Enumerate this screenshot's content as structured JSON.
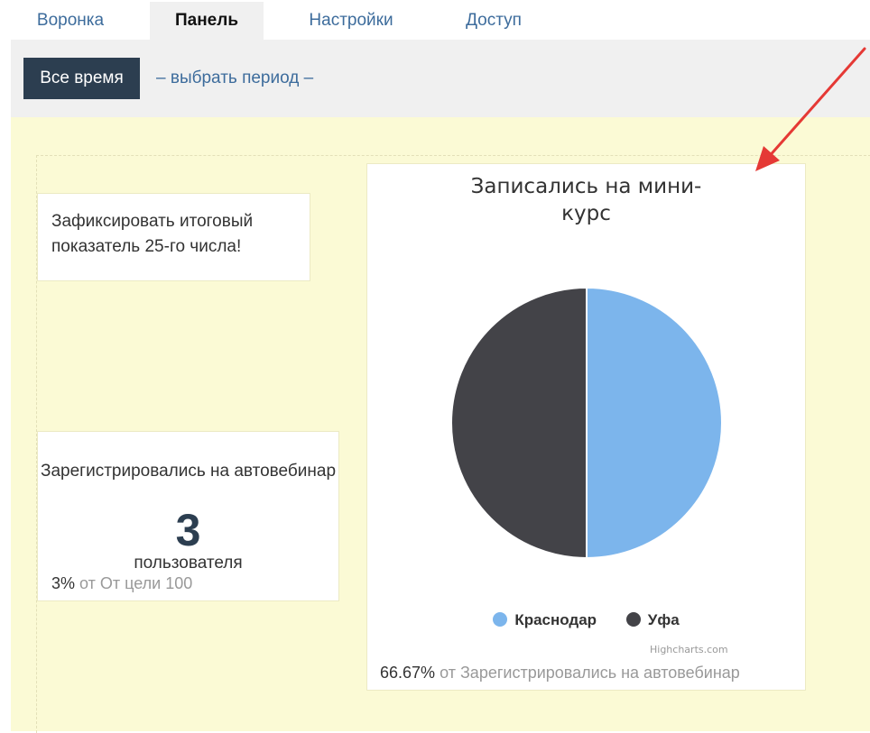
{
  "tabs": [
    {
      "label": "Воронка",
      "active": false
    },
    {
      "label": "Панель",
      "active": true
    },
    {
      "label": "Настройки",
      "active": false
    },
    {
      "label": "Доступ",
      "active": false
    }
  ],
  "toolbar": {
    "period_button": "Все время",
    "period_link": "– выбрать период –"
  },
  "widgets": {
    "note": {
      "text": "Зафиксировать итоговый показатель 25-го числа!"
    },
    "registered": {
      "title": "Зарегистрировались на автовебинар",
      "value": "3",
      "unit": "пользователя",
      "percent": "3%",
      "goal_text": "от От цели 100"
    },
    "chart_card": {
      "percent": "66.67%",
      "relative_text": "от Зарегистрировались на автовебинар",
      "credit": "Highcharts.com"
    }
  },
  "chart_data": {
    "type": "pie",
    "title": "Записались на мини-курс",
    "series": [
      {
        "name": "Краснодар",
        "value": 1,
        "color": "#7cb5ec"
      },
      {
        "name": "Уфа",
        "value": 1,
        "color": "#434348"
      }
    ],
    "legend_position": "bottom-center"
  },
  "colors": {
    "accent": "#2c3e50",
    "link": "#3d6c9c",
    "board_bg": "#fbfad5",
    "annotation": "#e53935"
  }
}
